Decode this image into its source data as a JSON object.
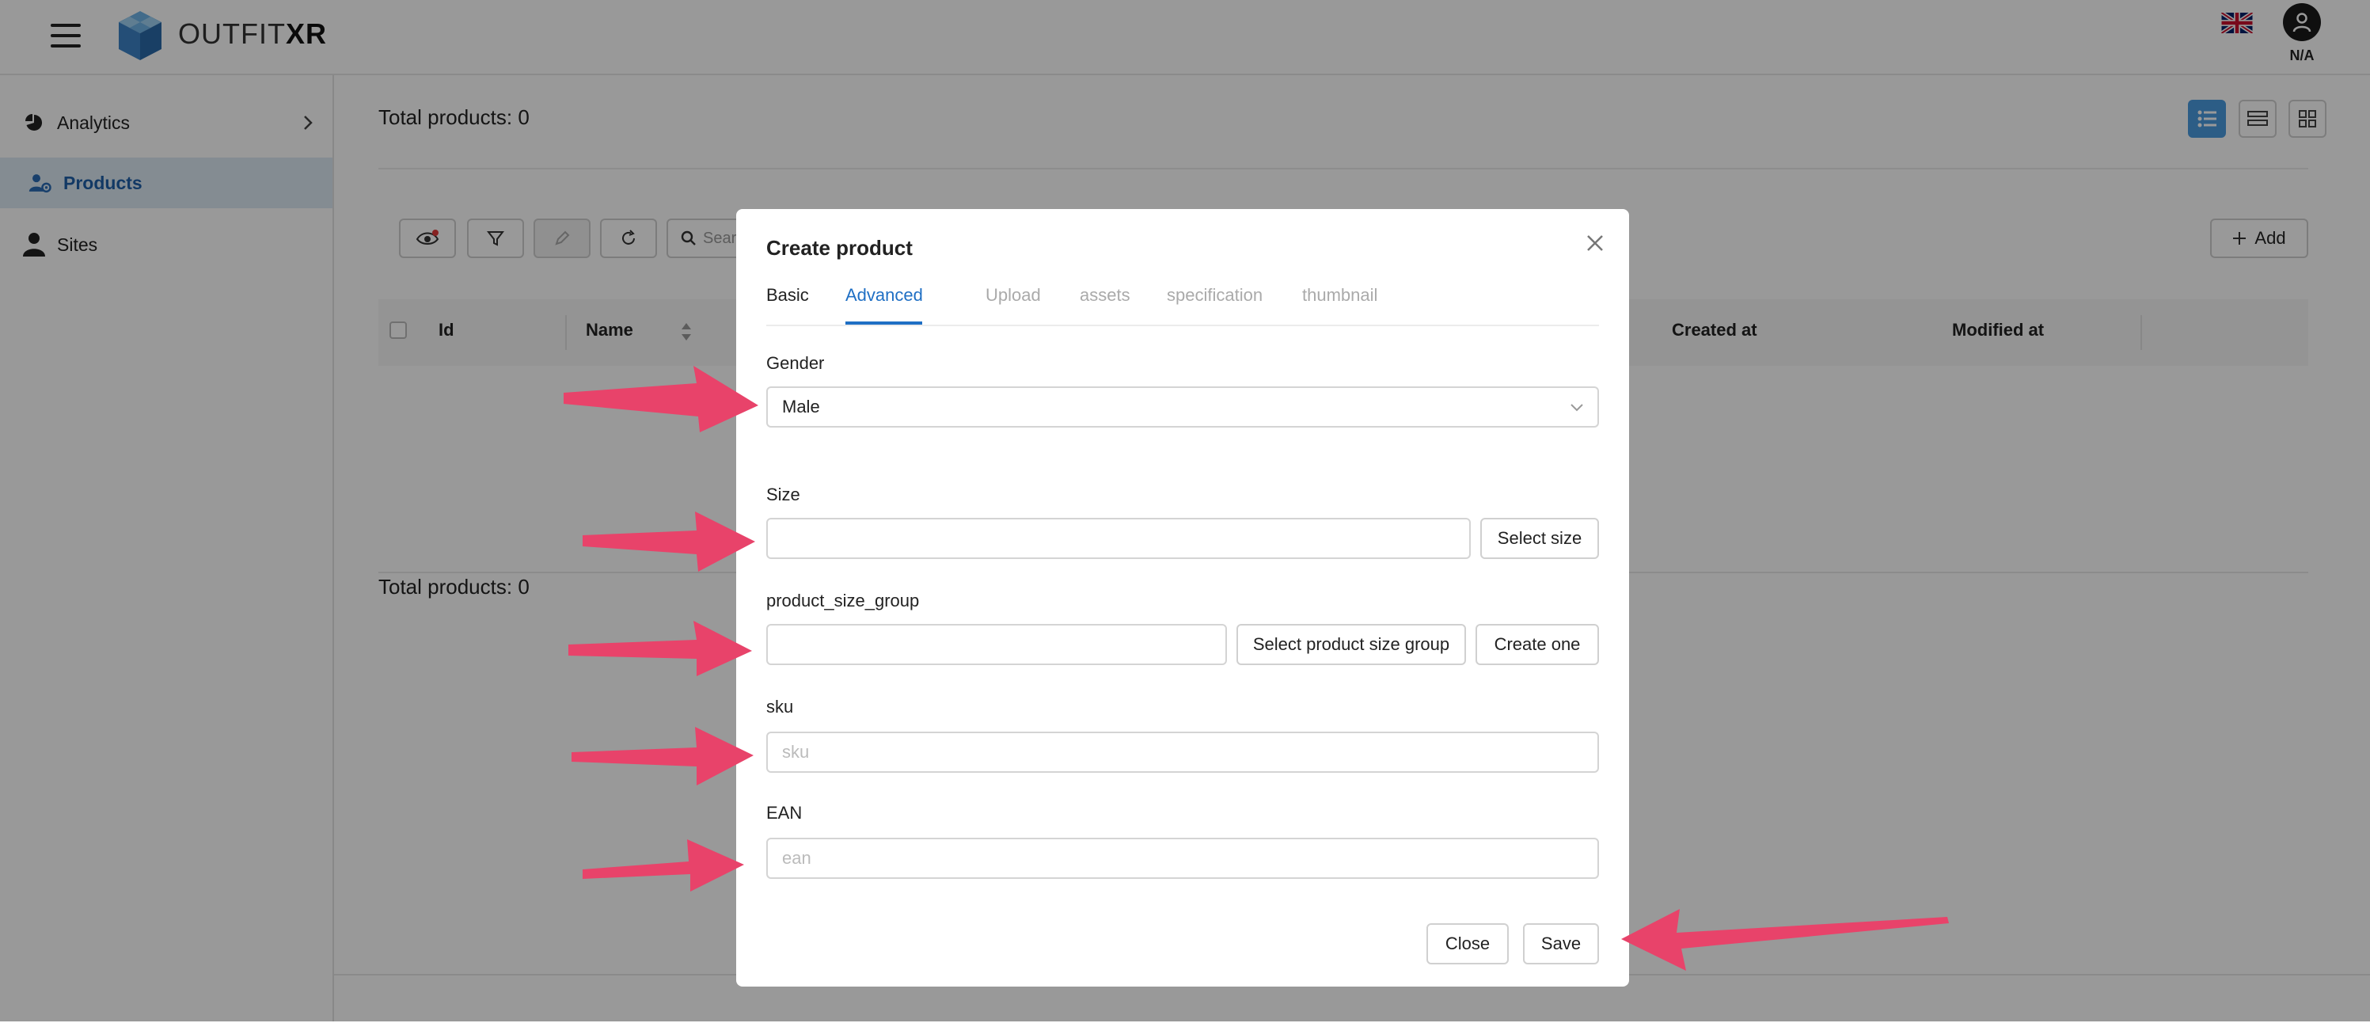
{
  "app": {
    "brand_light": "OUTFIT",
    "brand_bold": "XR",
    "user_label": "N/A",
    "accent_color": "#1f6fc4",
    "arrow_color": "#e8436a"
  },
  "sidebar": {
    "items": [
      {
        "label": "Analytics",
        "icon": "pie-chart-icon"
      },
      {
        "label": "Products",
        "icon": "users-gear-icon"
      },
      {
        "label": "Sites",
        "icon": "person-icon"
      }
    ]
  },
  "main": {
    "total_top": "Total products: 0",
    "total_bottom": "Total products: 0",
    "search_placeholder": "Sear",
    "add_label": "Add",
    "columns": [
      "Id",
      "Name",
      "Created at",
      "Modified at"
    ]
  },
  "modal": {
    "title": "Create product",
    "tabs": [
      "Basic",
      "Advanced",
      "Upload",
      "assets",
      "specification",
      "thumbnail"
    ],
    "active_tab": "Advanced",
    "fields": {
      "gender": {
        "label": "Gender",
        "value": "Male"
      },
      "size": {
        "label": "Size",
        "value": "",
        "button": "Select size"
      },
      "size_group": {
        "label": "product_size_group",
        "value": "",
        "select_button": "Select product size group",
        "create_button": "Create one"
      },
      "sku": {
        "label": "sku",
        "placeholder": "sku"
      },
      "ean": {
        "label": "EAN",
        "placeholder": "ean"
      }
    },
    "close_label": "Close",
    "save_label": "Save"
  }
}
